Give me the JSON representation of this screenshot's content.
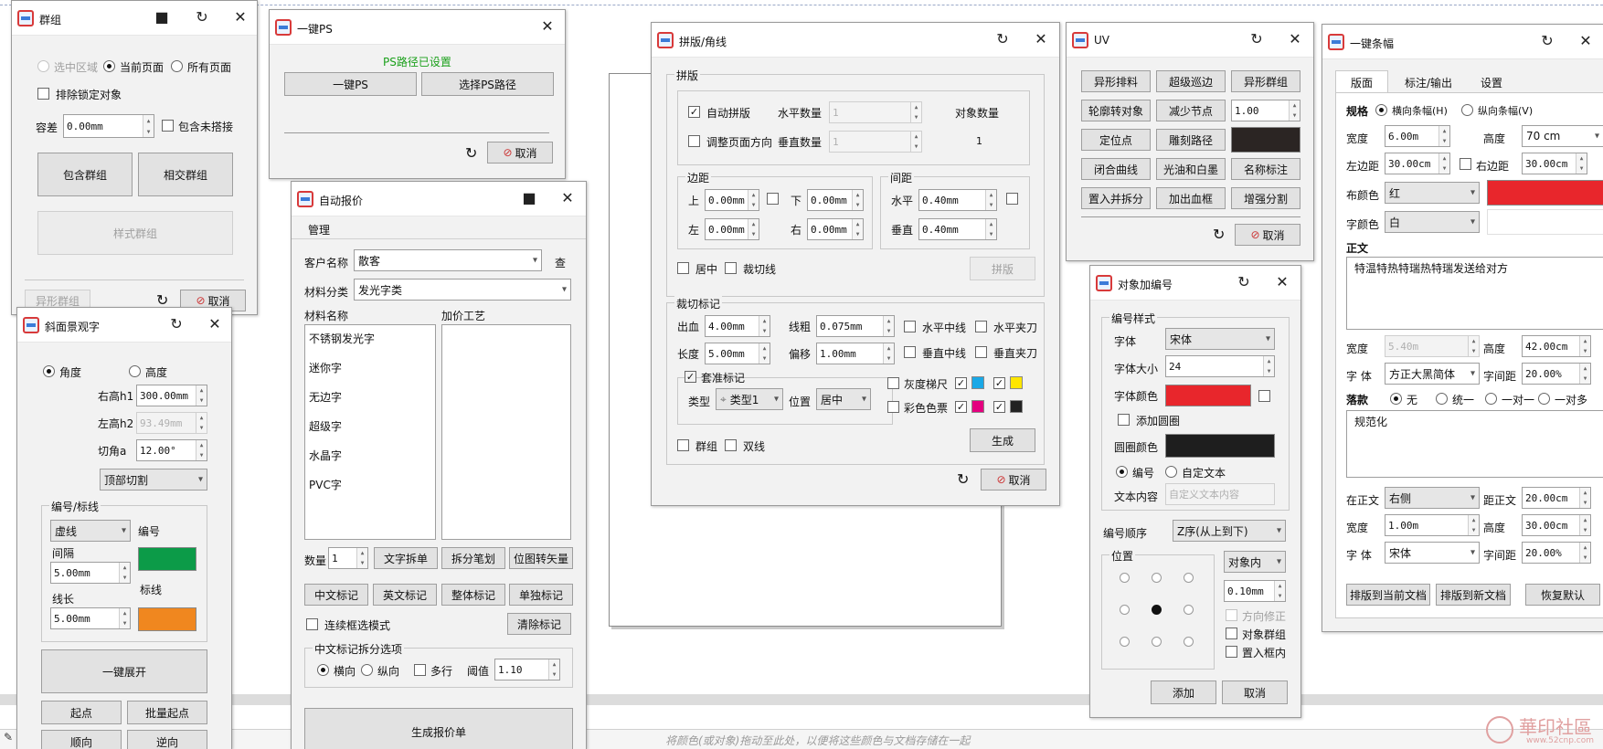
{
  "status_hint": "将颜色(或对象)拖动至此处，以便将这些颜色与文档存储在一起",
  "watermark": {
    "text": "華印社區",
    "url": "www.52cnp.com"
  },
  "group": {
    "title": "群组",
    "opt_selected": "选中区域",
    "opt_current": "当前页面",
    "opt_all": "所有页面",
    "exclude_locked": "排除锁定对象",
    "tolerance_label": "容差",
    "tolerance_value": "0.00mm",
    "include_unlapped": "包含未搭接",
    "contain_group": "包含群组",
    "intersect_group": "相交群组",
    "style_group": "样式群组",
    "shape_group": "异形群组",
    "cancel": "取消"
  },
  "ps": {
    "title": "一键PS",
    "status": "PS路径已设置",
    "onekey": "一键PS",
    "choose_path": "选择PS路径",
    "cancel": "取消"
  },
  "bevel": {
    "title": "斜面景观字",
    "angle": "角度",
    "height": "高度",
    "right_h_label": "右高h1",
    "right_h_value": "300.00mm",
    "left_h_label": "左高h2",
    "left_h_value": "93.49mm",
    "cut_angle_label": "切角a",
    "cut_angle_value": "12.00°",
    "cut_mode": "顶部切割",
    "group_title": "编号/标线",
    "line_style": "虚线",
    "number_label": "编号",
    "spacing_label": "间隔",
    "spacing_value": "5.00mm",
    "length_label": "线长",
    "length_value": "5.00mm",
    "mark_label": "标线",
    "expand": "一键展开",
    "start": "起点",
    "batch_start": "批量起点",
    "forward": "顺向",
    "reverse": "逆向",
    "colors": {
      "number": "#0c9b48",
      "mark": "#f0871f"
    }
  },
  "quote": {
    "title": "自动报价",
    "menu": "管理",
    "customer_label": "客户名称",
    "customer_value": "散客",
    "lookup": "查",
    "material_cat_label": "材料分类",
    "material_cat_value": "发光字类",
    "material_name_header": "材料名称",
    "extra_craft_header": "加价工艺",
    "materials": [
      "不锈钢发光字",
      "迷你字",
      "无边字",
      "超级字",
      "水晶字",
      "PVC字"
    ],
    "qty_label": "数量",
    "qty_value": "1",
    "split_text": "文字拆单",
    "split_stroke": "拆分笔划",
    "bitmap_vector": "位图转矢量",
    "cn_mark": "中文标记",
    "en_mark": "英文标记",
    "whole_mark": "整体标记",
    "single_mark": "单独标记",
    "continuous": "连续框选模式",
    "clear_mark": "清除标记",
    "cn_split_title": "中文标记拆分选项",
    "horizontal": "横向",
    "vertical": "纵向",
    "multiline": "多行",
    "threshold_label": "阈值",
    "threshold_value": "1.10",
    "generate": "生成报价单"
  },
  "imposition": {
    "title": "拼版/角线",
    "section": "拼版",
    "auto": "自动拼版",
    "h_count_label": "水平数量",
    "h_count": "1",
    "obj_count_label": "对象数量",
    "obj_count": "1",
    "adjust_dir": "调整页面方向",
    "v_count_label": "垂直数量",
    "v_count": "1",
    "margin_title": "边距",
    "top": "上",
    "top_v": "0.00mm",
    "bottom": "下",
    "bottom_v": "0.00mm",
    "left": "左",
    "left_v": "0.00mm",
    "right": "右",
    "right_v": "0.00mm",
    "gap_title": "间距",
    "gap_h": "水平",
    "gap_h_v": "0.40mm",
    "gap_v": "垂直",
    "gap_v_v": "0.40mm",
    "center": "居中",
    "cut_line": "裁切线",
    "impose_btn": "拼版",
    "crop_title": "裁切标记",
    "bleed": "出血",
    "bleed_v": "4.00mm",
    "thick": "线粗",
    "thick_v": "0.075mm",
    "len": "长度",
    "len_v": "5.00mm",
    "offset": "偏移",
    "offset_v": "1.00mm",
    "h_center": "水平中线",
    "h_clip": "水平夹刀",
    "v_center": "垂直中线",
    "v_clip": "垂直夹刀",
    "reg_mark": "套准标记",
    "type_label": "类型",
    "type_value": "类型1",
    "pos_label": "位置",
    "pos_value": "居中",
    "gray_scale": "灰度梯尺",
    "color_bar": "彩色色票",
    "group": "群组",
    "double": "双线",
    "generate": "生成",
    "cancel": "取消"
  },
  "uv": {
    "title": "UV",
    "buttons": [
      [
        "异形排料",
        "超级巡边",
        "异形群组"
      ],
      [
        "轮廓转对象",
        "减少节点",
        ""
      ],
      [
        "定位点",
        "雕刻路径",
        ""
      ],
      [
        "闭合曲线",
        "光油和白墨",
        "名称标注"
      ],
      [
        "置入并拆分",
        "加出血框",
        "增强分割"
      ]
    ],
    "node_value": "1.00",
    "cancel": "取消",
    "swatch": "#2b2523"
  },
  "numbering": {
    "title": "对象加编号",
    "style_title": "编号样式",
    "font_label": "字体",
    "font_value": "宋体",
    "size_label": "字体大小",
    "size_value": "24",
    "color_label": "字体颜色",
    "add_circle": "添加圆圈",
    "circle_color_label": "圆圈颜色",
    "opt_number": "编号",
    "opt_custom": "自定文本",
    "text_label": "文本内容",
    "text_placeholder": "自定义文本内容",
    "order_label": "编号顺序",
    "order_value": "Z序(从上到下)",
    "pos_title": "位置",
    "inside": "对象内",
    "offset": "0.10mm",
    "dir_fix": "方向修正",
    "obj_group": "对象群组",
    "in_frame": "置入框内",
    "add": "添加",
    "cancel": "取消",
    "colors": {
      "font": "#e8262c",
      "circle": "#1e1e1e"
    }
  },
  "banner": {
    "title": "一键条幅",
    "tabs": [
      "版面",
      "标注/输出",
      "设置"
    ],
    "spec": "规格",
    "h_banner": "横向条幅(H)",
    "v_banner": "纵向条幅(V)",
    "width_label": "宽度",
    "width_value": "6.00m",
    "height_label": "高度",
    "height_value": "70 cm",
    "left_m_label": "左边距",
    "left_m_value": "30.00cm",
    "right_m_label": "右边距",
    "right_m_value": "30.00cm",
    "cloth_label": "布颜色",
    "cloth_value": "红",
    "text_color_label": "字颜色",
    "text_color_value": "白",
    "body_title": "正文",
    "body_text": "特温特热特瑞热特瑞发送给对方",
    "b_width_label": "宽度",
    "b_width_value": "5.40m",
    "b_height_label": "高度",
    "b_height_value": "42.00cm",
    "b_font_label": "字 体",
    "b_font_value": "方正大黑简体",
    "b_spacing_label": "字间距",
    "b_spacing_value": "20.00%",
    "sign_title": "落款",
    "sign_none": "无",
    "sign_uniform": "统一",
    "sign_one": "一对一",
    "sign_many": "一对多",
    "sign_text": "规范化",
    "at_body_label": "在正文",
    "at_body_value": "右侧",
    "dist_label": "距正文",
    "dist_value": "20.00cm",
    "s_width_label": "宽度",
    "s_width_value": "1.00m",
    "s_height_label": "高度",
    "s_height_value": "30.00cm",
    "s_font_label": "字 体",
    "s_font_value": "宋体",
    "s_spacing_label": "字间距",
    "s_spacing_value": "20.00%",
    "to_current": "排版到当前文档",
    "to_new": "排版到新文档",
    "restore": "恢复默认",
    "colors": {
      "cloth": "#e8262c",
      "text": "#ffffff"
    }
  }
}
